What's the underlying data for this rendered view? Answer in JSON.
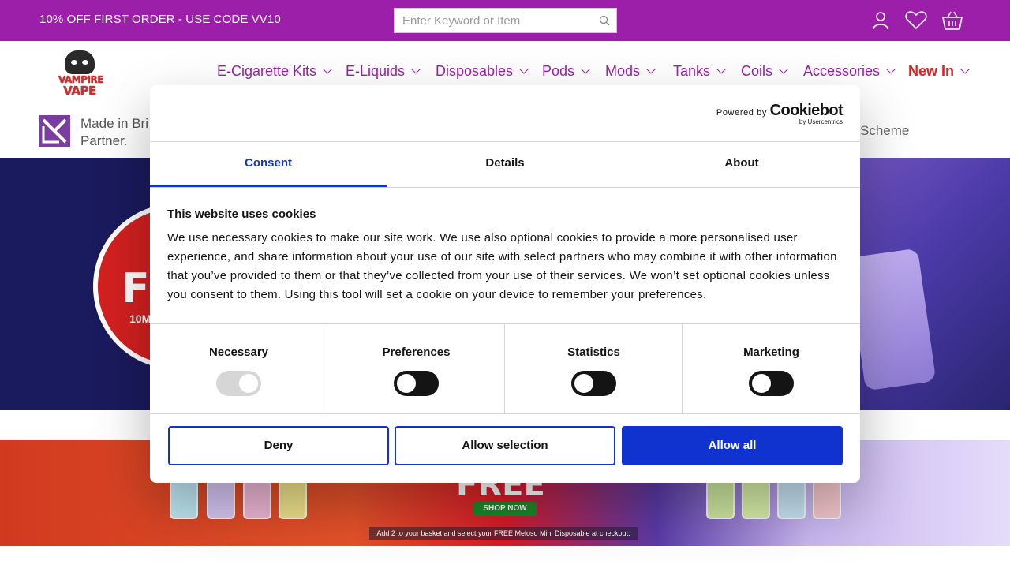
{
  "topbar": {
    "promo": "10% OFF FIRST ORDER - USE CODE VV10",
    "search_placeholder": "Enter Keyword or Item"
  },
  "logo": {
    "line1": "VAMPIRE",
    "line2": "VAPE"
  },
  "nav": {
    "items": [
      {
        "label": "E-Cigarette Kits"
      },
      {
        "label": "E-Liquids"
      },
      {
        "label": "Disposables"
      },
      {
        "label": "Pods"
      },
      {
        "label": "Mods"
      },
      {
        "label": "Tanks"
      },
      {
        "label": "Coils"
      },
      {
        "label": "Accessories"
      },
      {
        "label": "New In"
      }
    ]
  },
  "strip": {
    "left_text": "Made in Bri Partner.",
    "right_text": "Scheme"
  },
  "hero": {
    "badge_big": "FI",
    "badge_small": "10M"
  },
  "banner2": {
    "free_text": "FREE",
    "shop_button": "SHOP NOW",
    "note": "Add 2 to your basket and select your FREE Meloso Mini Disposable at checkout."
  },
  "cookie": {
    "powered_by": "Powered by",
    "brand": "Cookiebot",
    "brand_sub": "by Usercentrics",
    "tabs": [
      "Consent",
      "Details",
      "About"
    ],
    "title": "This website uses cookies",
    "text": "We use necessary cookies to make our site work. We use also optional cookies to provide a more personalised user experience, and share information about your use of our site with select partners who may combine it with other information that you’ve provided to them or that they’ve collected from your use of their services. We won’t set optional cookies unless you consent to them. Using this tool will set a cookie on your device to remember your preferences.",
    "categories": [
      {
        "label": "Necessary",
        "state": "on-disabled"
      },
      {
        "label": "Preferences",
        "state": "off"
      },
      {
        "label": "Statistics",
        "state": "off"
      },
      {
        "label": "Marketing",
        "state": "off"
      }
    ],
    "buttons": {
      "deny": "Deny",
      "allow_selection": "Allow selection",
      "allow_all": "Allow all"
    }
  },
  "colors": {
    "brand_purple": "#9b1fa8",
    "new_red": "#e02222",
    "cookie_blue": "#1032cf"
  }
}
